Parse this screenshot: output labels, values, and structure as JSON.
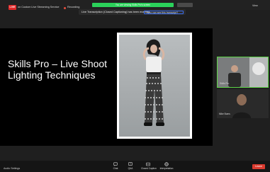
{
  "topbar": {
    "live_label": "LIVE",
    "stream_label": "on Custom Live Streaming Service",
    "recording_label": "Recording",
    "banner_text": "You are viewing Skills Pro's screen",
    "view_label": "View"
  },
  "caption_notice": {
    "text": "Live Transcription (Closed Captioning) has been enabled.",
    "link": "Who can see this transcript?"
  },
  "slide": {
    "title": "Skills Pro – Live Shoot Lighting Techniques"
  },
  "participants": [
    {
      "name": "Skills Pro"
    },
    {
      "name": "Mike Bums"
    }
  ],
  "toolbar": {
    "audio_settings": "Audio Settings",
    "chat": "Chat",
    "qa": "Q&A",
    "closed_caption": "Closed Caption",
    "interpretation": "Interpretation",
    "leave": "Leave"
  },
  "colors": {
    "live_red": "#e02828",
    "banner_green": "#2bd15a",
    "active_speaker_border": "#5cd347",
    "leave_red": "#d93a2e"
  }
}
